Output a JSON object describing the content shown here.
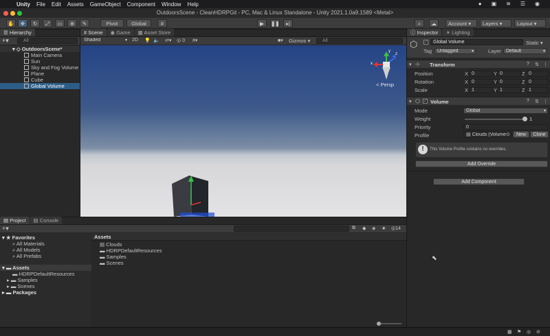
{
  "mac_menu": {
    "app": "Unity",
    "items": [
      "File",
      "Edit",
      "Assets",
      "GameObject",
      "Component",
      "Window",
      "Help"
    ]
  },
  "window_title": "OutdoorsScene - CleanHDRPGit - PC, Mac & Linux Standalone - Unity 2021.1.0a9.1589 <Metal>",
  "toolbar": {
    "pivot": "Pivot",
    "global": "Global",
    "account": "Account",
    "layers": "Layers",
    "layout": "Layout"
  },
  "hierarchy": {
    "tab": "Hierarchy",
    "search_placeholder": "All",
    "scene": "OutdoorsScene*",
    "items": [
      "Main Camera",
      "Sun",
      "Sky and Fog Volume",
      "Plane",
      "Cube",
      "Global Volume"
    ]
  },
  "scene_tabs": {
    "scene": "Scene",
    "game": "Game",
    "asset_store": "Asset Store"
  },
  "scene_bar": {
    "shading": "Shaded",
    "mode_2d": "2D",
    "gizmos": "Gizmos",
    "search_placeholder": "All",
    "hidden_count": "0",
    "persp": "< Persp"
  },
  "gizmo_axes": {
    "x": "x",
    "y": "y",
    "z": "z"
  },
  "project": {
    "tab_project": "Project",
    "tab_console": "Console",
    "favorites": "Favorites",
    "fav_items": [
      "All Materials",
      "All Models",
      "All Prefabs"
    ],
    "assets_root": "Assets",
    "asset_tree": [
      "HDRPDefaultResources",
      "Samples",
      "Scenes"
    ],
    "packages": "Packages",
    "breadcrumb": "Assets",
    "asset_items": [
      "Clouds",
      "HDRPDefaultResources",
      "Samples",
      "Scenes"
    ],
    "count": "14"
  },
  "inspector": {
    "tab": "Inspector",
    "tab_lighting": "Lighting",
    "object_name": "Global Volume",
    "static": "Static",
    "tag_label": "Tag",
    "tag": "Untagged",
    "layer_label": "Layer",
    "layer": "Default",
    "transform": {
      "title": "Transform",
      "rows": [
        {
          "label": "Position",
          "x": "0",
          "y": "0",
          "z": "0"
        },
        {
          "label": "Rotation",
          "x": "0",
          "y": "0",
          "z": "0"
        },
        {
          "label": "Scale",
          "x": "1",
          "y": "1",
          "z": "1"
        }
      ]
    },
    "volume": {
      "title": "Volume",
      "mode_label": "Mode",
      "mode": "Global",
      "weight_label": "Weight",
      "weight": "1",
      "priority_label": "Priority",
      "priority": "0",
      "profile_label": "Profile",
      "profile": "Clouds (Volume",
      "new_btn": "New",
      "clone_btn": "Clone",
      "info": "This Volume Profile contains no overrides.",
      "add_override": "Add Override"
    },
    "add_component": "Add Component"
  },
  "colors": {
    "accent": "#2c5d87",
    "background": "#282828",
    "sky_top": "#254486",
    "ground": "#e3e3e5"
  }
}
